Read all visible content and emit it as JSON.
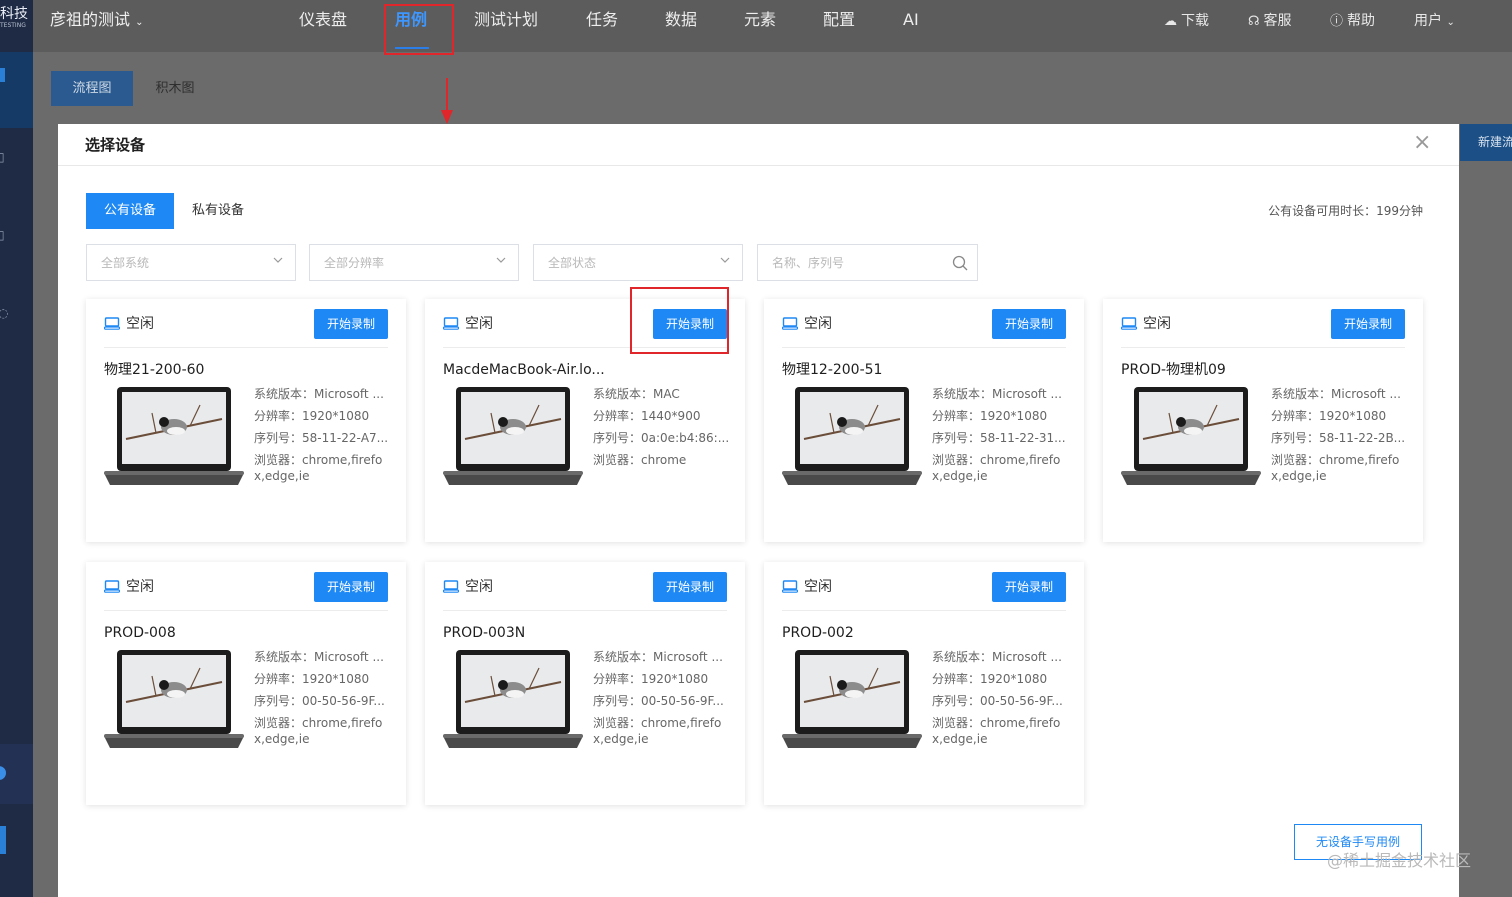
{
  "sidebar": {
    "logo_text": "科技",
    "logo_sub": "TESTING"
  },
  "topnav": {
    "project": "彦祖的测试",
    "items": [
      {
        "label": "仪表盘"
      },
      {
        "label": "用例"
      },
      {
        "label": "测试计划"
      },
      {
        "label": "任务"
      },
      {
        "label": "数据"
      },
      {
        "label": "元素"
      },
      {
        "label": "配置"
      },
      {
        "label": "AI"
      }
    ],
    "active_item": "用例",
    "right": {
      "download": "下载",
      "service": "客服",
      "help": "帮助",
      "user": "用户"
    }
  },
  "page": {
    "subtabs": [
      {
        "label": "流程图"
      },
      {
        "label": "积木图"
      }
    ],
    "new_button": "新建流"
  },
  "modal": {
    "title": "选择设备",
    "tabs": [
      {
        "label": "公有设备"
      },
      {
        "label": "私有设备"
      }
    ],
    "available_time": "公有设备可用时长：199分钟",
    "filters": {
      "system": "全部系统",
      "resolution": "全部分辨率",
      "status": "全部状态",
      "search_placeholder": "名称、序列号"
    },
    "devices": [
      {
        "status": "空闲",
        "record_label": "开始录制",
        "name": "物理21-200-60",
        "os_label": "系统版本：",
        "os": "Microsoft ...",
        "res_label": "分辨率：",
        "res": "1920*1080",
        "serial_label": "序列号：",
        "serial": "58-11-22-A7...",
        "browser_label": "浏览器：",
        "browser": "chrome,firefo",
        "browser_more": "x,edge,ie"
      },
      {
        "status": "空闲",
        "record_label": "开始录制",
        "name": "MacdeMacBook-Air.lo...",
        "os_label": "系统版本：",
        "os": "MAC",
        "res_label": "分辨率：",
        "res": "1440*900",
        "serial_label": "序列号：",
        "serial": "0a:0e:b4:86:...",
        "browser_label": "浏览器：",
        "browser": "chrome",
        "browser_more": ""
      },
      {
        "status": "空闲",
        "record_label": "开始录制",
        "name": "物理12-200-51",
        "os_label": "系统版本：",
        "os": "Microsoft ...",
        "res_label": "分辨率：",
        "res": "1920*1080",
        "serial_label": "序列号：",
        "serial": "58-11-22-31...",
        "browser_label": "浏览器：",
        "browser": "chrome,firefo",
        "browser_more": "x,edge,ie"
      },
      {
        "status": "空闲",
        "record_label": "开始录制",
        "name": "PROD-物理机09",
        "os_label": "系统版本：",
        "os": "Microsoft ...",
        "res_label": "分辨率：",
        "res": "1920*1080",
        "serial_label": "序列号：",
        "serial": "58-11-22-2B...",
        "browser_label": "浏览器：",
        "browser": "chrome,firefo",
        "browser_more": "x,edge,ie"
      },
      {
        "status": "空闲",
        "record_label": "开始录制",
        "name": "PROD-008",
        "os_label": "系统版本：",
        "os": "Microsoft ...",
        "res_label": "分辨率：",
        "res": "1920*1080",
        "serial_label": "序列号：",
        "serial": "00-50-56-9F...",
        "browser_label": "浏览器：",
        "browser": "chrome,firefo",
        "browser_more": "x,edge,ie"
      },
      {
        "status": "空闲",
        "record_label": "开始录制",
        "name": "PROD-003N",
        "os_label": "系统版本：",
        "os": "Microsoft ...",
        "res_label": "分辨率：",
        "res": "1920*1080",
        "serial_label": "序列号：",
        "serial": "00-50-56-9F...",
        "browser_label": "浏览器：",
        "browser": "chrome,firefo",
        "browser_more": "x,edge,ie"
      },
      {
        "status": "空闲",
        "record_label": "开始录制",
        "name": "PROD-002",
        "os_label": "系统版本：",
        "os": "Microsoft ...",
        "res_label": "分辨率：",
        "res": "1920*1080",
        "serial_label": "序列号：",
        "serial": "00-50-56-9F...",
        "browser_label": "浏览器：",
        "browser": "chrome,firefo",
        "browser_more": "x,edge,ie"
      }
    ],
    "no_device_button": "无设备手写用例"
  },
  "watermark": "@稀土掘金技术社区",
  "colors": {
    "primary": "#1e88f5",
    "annotation": "#e0262a",
    "sidebar": "#1f2a44"
  }
}
